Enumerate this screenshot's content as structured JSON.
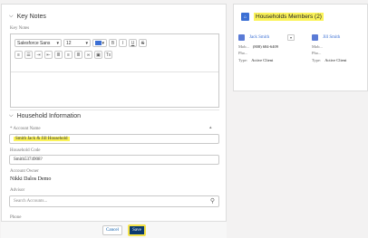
{
  "key_notes": {
    "section_title": "Key Notes",
    "field_label": "Key Notes",
    "toolbar": {
      "font_family": "Salesforce Sans",
      "font_size": "12",
      "bold": "B",
      "italic": "I",
      "underline": "U",
      "strike": "S",
      "clear": "Tx"
    }
  },
  "household_info": {
    "section_title": "Household Information",
    "account_name_label": "* Account Name",
    "account_name_value": "Smith Jack & Jill Household",
    "household_code_label": "Household Code",
    "household_code_value": "Smith5374908?",
    "account_owner_label": "Account Owner",
    "account_owner_value": "Nikki Dalos Demo",
    "advisor_label": "Advisor",
    "advisor_placeholder": "Search Accounts...",
    "phone_label": "Phone"
  },
  "footer": {
    "cancel_label": "Cancel",
    "save_label": "Save"
  },
  "household_members": {
    "title": "Households Members (2)",
    "members": [
      {
        "name": "Jack Smith",
        "mob_label": "Mob...",
        "mob_value": "(808) 684-6409",
        "pho_label": "Pho...",
        "type_label": "Type:",
        "type_value": "Active Client"
      },
      {
        "name": "Jill Smith",
        "mob_label": "Mob...",
        "mob_value": "",
        "pho_label": "Pho...",
        "type_label": "Type:",
        "type_value": "Active Client"
      }
    ]
  },
  "colors": {
    "highlight": "#fbf35a",
    "save_button": "#0b3a6e",
    "icon_blue": "#3b6fd4"
  }
}
